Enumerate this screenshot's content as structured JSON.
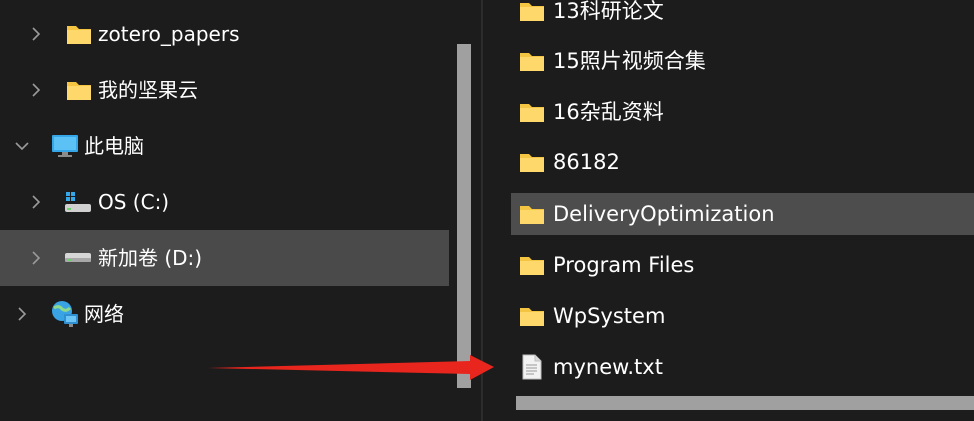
{
  "nav": {
    "items": [
      {
        "label": "zotero_papers",
        "icon": "folder-icon",
        "expanded": false
      },
      {
        "label": "我的坚果云",
        "icon": "folder-icon",
        "expanded": false
      },
      {
        "label": "此电脑",
        "icon": "this-pc-icon",
        "expanded": true
      },
      {
        "label": "OS (C:)",
        "icon": "windows-drive-icon",
        "expanded": false
      },
      {
        "label": "新加卷 (D:)",
        "icon": "drive-icon",
        "expanded": false,
        "selected": true
      },
      {
        "label": "网络",
        "icon": "network-icon",
        "expanded": false
      }
    ]
  },
  "files": {
    "items": [
      {
        "name": "13科研论文",
        "icon": "folder-icon"
      },
      {
        "name": "15照片视频合集",
        "icon": "folder-icon"
      },
      {
        "name": "16杂乱资料",
        "icon": "folder-icon"
      },
      {
        "name": "86182",
        "icon": "folder-icon"
      },
      {
        "name": "DeliveryOptimization",
        "icon": "folder-icon",
        "hover": true
      },
      {
        "name": "Program Files",
        "icon": "folder-icon"
      },
      {
        "name": "WpSystem",
        "icon": "folder-icon"
      },
      {
        "name": "mynew.txt",
        "icon": "text-file-icon"
      }
    ]
  },
  "annotation": {
    "icon": "red-arrow-icon",
    "color": "#e8261e"
  },
  "colors": {
    "background": "#1c1c1c",
    "selected": "#4a4a4a",
    "hover": "#4d4d4d",
    "folder": "#f4c542",
    "scrollbar": "#a0a0a0"
  }
}
